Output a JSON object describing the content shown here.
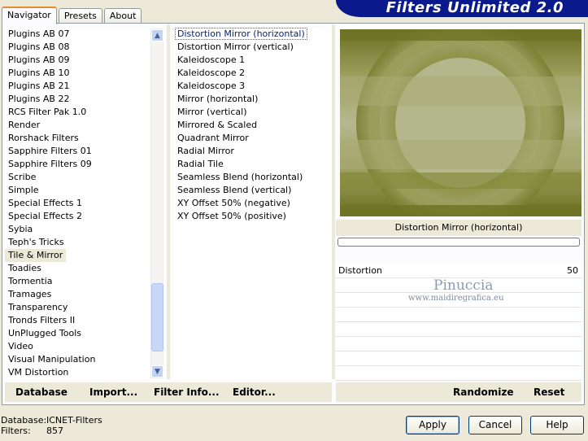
{
  "tabs": [
    "Navigator",
    "Presets",
    "About"
  ],
  "app_title": "Filters Unlimited 2.0",
  "categories": [
    "Plugins AB 07",
    "Plugins AB 08",
    "Plugins AB 09",
    "Plugins AB 10",
    "Plugins AB 21",
    "Plugins AB 22",
    "RCS Filter Pak 1.0",
    "Render",
    "Rorshack Filters",
    "Sapphire Filters 01",
    "Sapphire Filters 09",
    "Scribe",
    "Simple",
    "Special Effects 1",
    "Special Effects 2",
    "Sybia",
    "Teph's Tricks",
    "Tile & Mirror",
    "Toadies",
    "Tormentia",
    "Tramages",
    "Transparency",
    "Tronds Filters II",
    "UnPlugged Tools",
    "Video",
    "Visual Manipulation",
    "VM Distortion"
  ],
  "selected_category": "Tile & Mirror",
  "filters": [
    "Distortion Mirror (horizontal)",
    "Distortion Mirror (vertical)",
    "Kaleidoscope 1",
    "Kaleidoscope 2",
    "Kaleidoscope 3",
    "Mirror (horizontal)",
    "Mirror (vertical)",
    "Mirrored & Scaled",
    "Quadrant Mirror",
    "Radial Mirror",
    "Radial Tile",
    "Seamless Blend (horizontal)",
    "Seamless Blend (vertical)",
    "XY Offset 50% (negative)",
    "XY Offset 50% (positive)"
  ],
  "selected_filter": "Distortion Mirror (horizontal)",
  "preview_caption": "Distortion Mirror (horizontal)",
  "parameters": [
    {
      "label": "Distortion",
      "value": "50"
    }
  ],
  "watermark": {
    "name": "Pinuccia",
    "url": "www.maidiregrafica.eu"
  },
  "bottom_links": {
    "database": "Database",
    "import": "Import...",
    "filter_info": "Filter Info...",
    "editor": "Editor...",
    "randomize": "Randomize",
    "reset": "Reset"
  },
  "status": {
    "database_label": "Database:",
    "database_value": "ICNET-Filters",
    "filters_label": "Filters:",
    "filters_value": "857"
  },
  "buttons": {
    "apply": "Apply",
    "cancel": "Cancel",
    "help": "Help"
  },
  "colors": {
    "preview_dark": "#6e7324",
    "preview_light": "#b4b88c",
    "title_banner": "#0a1a8c"
  }
}
